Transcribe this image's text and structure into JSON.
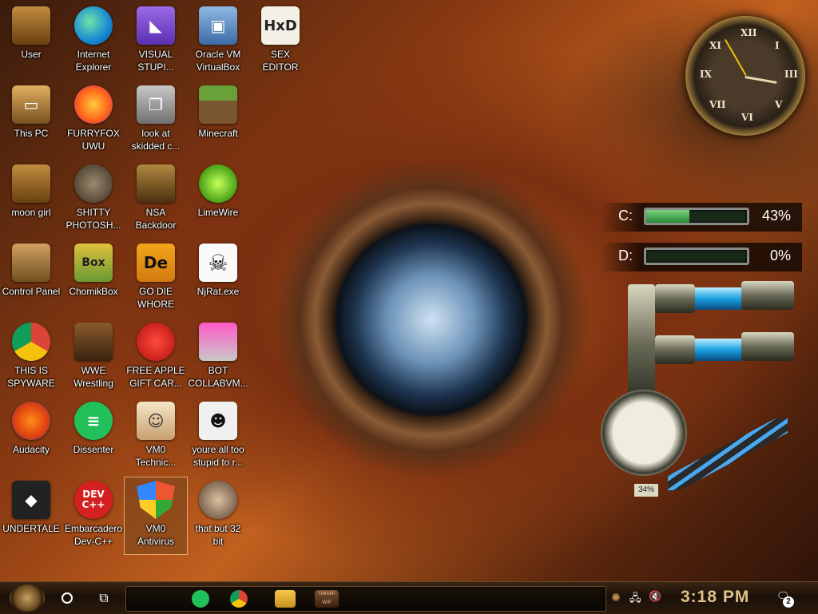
{
  "desktop_icons": [
    {
      "label": "User",
      "glyph": "",
      "style": "g-user",
      "icon": "user-folder-icon"
    },
    {
      "label": "Internet\nExplorer",
      "glyph": "",
      "style": "g-edge",
      "icon": "edge-icon"
    },
    {
      "label": "VISUAL\nSTUPI...",
      "glyph": "◣",
      "style": "g-vs",
      "icon": "visual-studio-icon"
    },
    {
      "label": "Oracle VM\nVirtualBox",
      "glyph": "▣",
      "style": "g-vbox",
      "icon": "virtualbox-icon"
    },
    {
      "label": "SEX\nEDITOR",
      "glyph": "HxD",
      "style": "g-hxd",
      "icon": "hxd-icon"
    },
    {
      "label": "This PC",
      "glyph": "▭",
      "style": "g-pc",
      "icon": "computer-icon"
    },
    {
      "label": "FURRYFOX\nUWU",
      "glyph": "",
      "style": "g-fox",
      "icon": "firefox-icon"
    },
    {
      "label": "look at\nskidded c...",
      "glyph": "❐",
      "style": "g-stack",
      "icon": "stack-icon"
    },
    {
      "label": "Minecraft",
      "glyph": "",
      "style": "g-mc",
      "icon": "minecraft-icon"
    },
    {
      "label": "moon girl",
      "glyph": "",
      "style": "g-user",
      "icon": "folder-icon"
    },
    {
      "label": "SHITTY\nPHOTOSH...",
      "glyph": "",
      "style": "g-gimp",
      "icon": "gimp-icon"
    },
    {
      "label": "NSA\nBackdoor",
      "glyph": "",
      "style": "g-nsa",
      "icon": "frame-icon"
    },
    {
      "label": "LimeWire",
      "glyph": "",
      "style": "g-lime",
      "icon": "limewire-icon"
    },
    {
      "label": "Control Panel",
      "glyph": "",
      "style": "g-cp",
      "icon": "control-panel-icon"
    },
    {
      "label": "ChomikBox",
      "glyph": "Box",
      "style": "g-box",
      "icon": "chomikbox-icon"
    },
    {
      "label": "GO DIE\nWHORE",
      "glyph": "De",
      "style": "g-de",
      "icon": "de-icon"
    },
    {
      "label": "NjRat.exe",
      "glyph": "☠",
      "style": "g-skull",
      "icon": "skull-icon"
    },
    {
      "label": "THIS IS\nSPYWARE",
      "glyph": "",
      "style": "g-chrome",
      "icon": "chrome-icon"
    },
    {
      "label": "WWE\nWrestling",
      "glyph": "",
      "style": "g-tv",
      "icon": "tv-icon"
    },
    {
      "label": "FREE APPLE\nGIFT CAR...",
      "glyph": "",
      "style": "g-apple",
      "icon": "apple-icon"
    },
    {
      "label": "BOT\nCOLLABVM...",
      "glyph": "",
      "style": "g-bot",
      "icon": "monitor-icon"
    },
    {
      "label": "Audacity",
      "glyph": "",
      "style": "g-aud",
      "icon": "audacity-icon"
    },
    {
      "label": "Dissenter",
      "glyph": "≡",
      "style": "g-diss",
      "icon": "dissenter-icon"
    },
    {
      "label": "VM0\nTechnic...",
      "glyph": "☺",
      "style": "g-doc",
      "icon": "technician-icon"
    },
    {
      "label": "youre all too\nstupid to r...",
      "glyph": "☻",
      "style": "g-face",
      "icon": "face-icon"
    },
    {
      "label": "UNDERTALE",
      "glyph": "◆",
      "style": "g-unity",
      "icon": "unity-icon"
    },
    {
      "label": "Embarcadero\nDev-C++",
      "glyph": "DEV\nC++",
      "style": "g-devcpp",
      "icon": "devcpp-icon"
    },
    {
      "label": "VM0\nAntivirus",
      "glyph": "",
      "style": "g-shield",
      "icon": "shield-icon",
      "selected": true
    },
    {
      "label": "that but 32\nbit",
      "glyph": "",
      "style": "g-portrait",
      "icon": "portrait-icon"
    }
  ],
  "drives": [
    {
      "letter": "C:",
      "percent_text": "43%",
      "fill_fraction": 0.43
    },
    {
      "letter": "D:",
      "percent_text": "0%",
      "fill_fraction": 0.0
    }
  ],
  "gauge": {
    "percent_text": "34%"
  },
  "taskbar": {
    "clock": "3:18 PM",
    "notification_count": "2",
    "pinned": [
      "Dissenter",
      "Google Chrome",
      "File Explorer",
      "WWE Wrestling"
    ],
    "wwe_thumb_text": "UMAMI W/P"
  },
  "colors": {
    "taskbar_clock": "#e0c088",
    "drive_fill": "#2a8a3a"
  }
}
